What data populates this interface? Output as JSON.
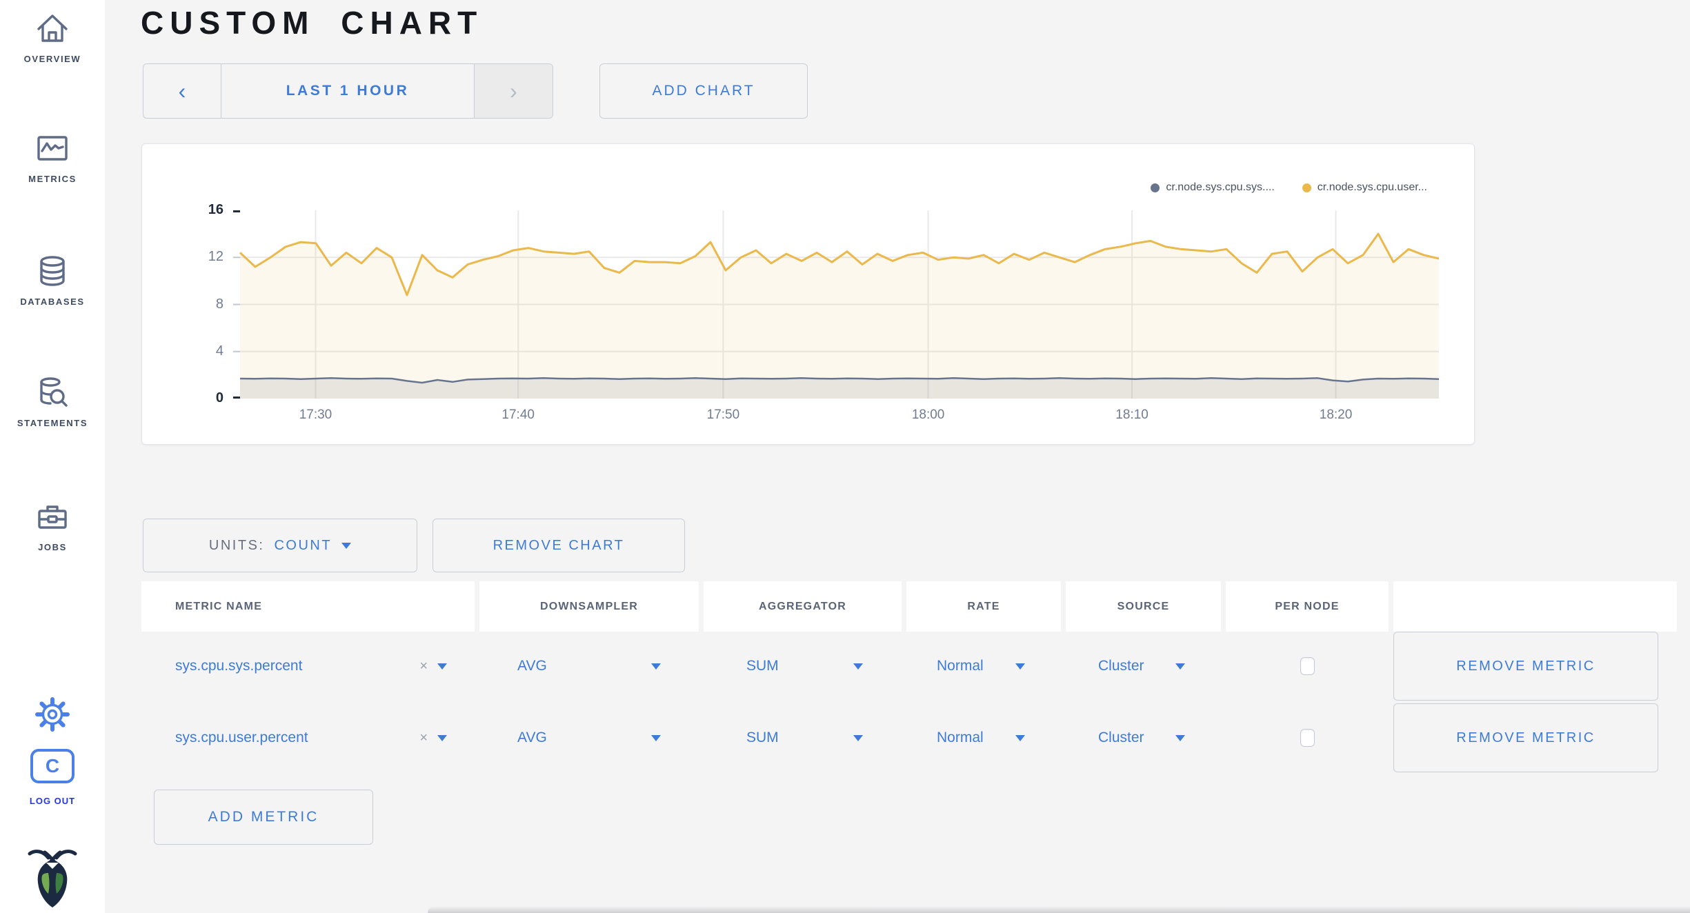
{
  "header": {
    "title": "CUSTOM CHART"
  },
  "toolbar": {
    "prev_label": "‹",
    "time_window": "LAST 1 HOUR",
    "next_label": "›",
    "add_chart": "ADD CHART"
  },
  "sidebar": {
    "items": [
      {
        "label": "OVERVIEW",
        "icon": "home-icon"
      },
      {
        "label": "METRICS",
        "icon": "metrics-icon"
      },
      {
        "label": "DATABASES",
        "icon": "database-icon"
      },
      {
        "label": "STATEMENTS",
        "icon": "statements-icon"
      },
      {
        "label": "JOBS",
        "icon": "jobs-icon"
      }
    ],
    "logout": {
      "label": "LOG OUT",
      "icon_letter": "C"
    }
  },
  "chart_card": {
    "legend": [
      {
        "label": "cr.node.sys.cpu.sys....",
        "color": "#67748e"
      },
      {
        "label": "cr.node.sys.cpu.user...",
        "color": "#eab84b"
      }
    ]
  },
  "chart_data": {
    "type": "area",
    "title": "",
    "xlabel": "",
    "ylabel": "",
    "ylim": [
      0,
      16
    ],
    "yticks": [
      0,
      4,
      8,
      12,
      16
    ],
    "grid": true,
    "legend_position": "top-right",
    "xticks": [
      {
        "label": "17:30",
        "frac": 0.063
      },
      {
        "label": "17:40",
        "frac": 0.232
      },
      {
        "label": "17:50",
        "frac": 0.403
      },
      {
        "label": "18:00",
        "frac": 0.574
      },
      {
        "label": "18:10",
        "frac": 0.744
      },
      {
        "label": "18:20",
        "frac": 0.914
      }
    ],
    "series": [
      {
        "name": "cr.node.sys.cpu.user...",
        "color": "#eab84b",
        "fill": "rgba(234,184,75,0.10)",
        "line_width": 3,
        "values": [
          12.4,
          11.2,
          12.0,
          12.9,
          13.3,
          13.2,
          11.3,
          12.4,
          11.5,
          12.8,
          12.0,
          8.8,
          12.2,
          10.9,
          10.3,
          11.4,
          11.8,
          12.1,
          12.6,
          12.8,
          12.5,
          12.4,
          12.3,
          12.5,
          11.1,
          10.7,
          11.7,
          11.6,
          11.6,
          11.5,
          12.1,
          13.3,
          10.9,
          12.0,
          12.6,
          11.5,
          12.3,
          11.7,
          12.4,
          11.6,
          12.5,
          11.4,
          12.3,
          11.7,
          12.2,
          12.4,
          11.8,
          12.0,
          11.9,
          12.2,
          11.5,
          12.3,
          11.8,
          12.4,
          12.0,
          11.6,
          12.2,
          12.7,
          12.9,
          13.2,
          13.4,
          12.9,
          12.7,
          12.6,
          12.5,
          12.7,
          11.5,
          10.7,
          12.3,
          12.5,
          10.8,
          12.0,
          12.7,
          11.5,
          12.2,
          14.0,
          11.6,
          12.7,
          12.2,
          11.9
        ]
      },
      {
        "name": "cr.node.sys.cpu.sys....",
        "color": "#67748e",
        "fill": "rgba(103,116,142,0.14)",
        "line_width": 2.5,
        "values": [
          1.7,
          1.68,
          1.72,
          1.7,
          1.66,
          1.7,
          1.74,
          1.7,
          1.68,
          1.72,
          1.7,
          1.5,
          1.35,
          1.58,
          1.42,
          1.62,
          1.66,
          1.7,
          1.72,
          1.7,
          1.74,
          1.7,
          1.68,
          1.72,
          1.7,
          1.66,
          1.7,
          1.72,
          1.68,
          1.7,
          1.74,
          1.7,
          1.66,
          1.72,
          1.7,
          1.68,
          1.7,
          1.74,
          1.7,
          1.68,
          1.72,
          1.7,
          1.66,
          1.7,
          1.72,
          1.7,
          1.68,
          1.74,
          1.7,
          1.66,
          1.7,
          1.72,
          1.68,
          1.7,
          1.74,
          1.7,
          1.68,
          1.72,
          1.7,
          1.66,
          1.7,
          1.72,
          1.7,
          1.68,
          1.74,
          1.7,
          1.66,
          1.72,
          1.7,
          1.68,
          1.7,
          1.74,
          1.55,
          1.45,
          1.62,
          1.7,
          1.68,
          1.72,
          1.7,
          1.66
        ]
      }
    ]
  },
  "controls": {
    "units_label": "UNITS:",
    "units_value": "COUNT",
    "remove_chart": "REMOVE CHART",
    "add_metric": "ADD METRIC"
  },
  "table": {
    "headers": [
      "METRIC NAME",
      "DOWNSAMPLER",
      "AGGREGATOR",
      "RATE",
      "SOURCE",
      "PER NODE",
      ""
    ],
    "rows": [
      {
        "metric": "sys.cpu.sys.percent",
        "clear": "×",
        "downsampler": "AVG",
        "aggregator": "SUM",
        "rate": "Normal",
        "source": "Cluster",
        "per_node_checked": false,
        "remove_label": "REMOVE METRIC"
      },
      {
        "metric": "sys.cpu.user.percent",
        "clear": "×",
        "downsampler": "AVG",
        "aggregator": "SUM",
        "rate": "Normal",
        "source": "Cluster",
        "per_node_checked": false,
        "remove_label": "REMOVE METRIC"
      }
    ]
  },
  "colors": {
    "accent_blue": "#3e7bd8",
    "logout_blue": "#2336e6",
    "series_sys": "#67748e",
    "series_user": "#eab84b",
    "page_bg": "#f4f4f5",
    "card_bg": "#ffffff",
    "border": "#c9ced6",
    "grid_line": "#e8e9eb",
    "axis_text": "#707c92",
    "axis_text_strong": "#222b3a"
  }
}
